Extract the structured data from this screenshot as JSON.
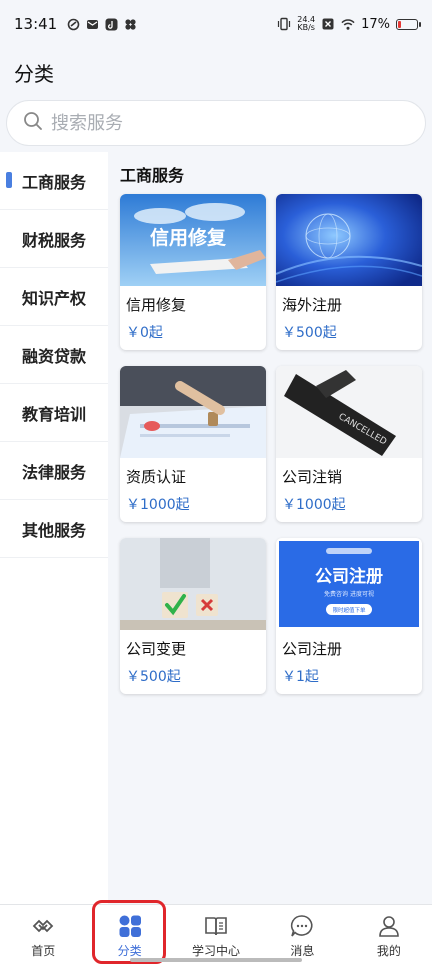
{
  "status": {
    "time": "13:41",
    "net_speed_value": "24.4",
    "net_speed_unit": "KB/s",
    "battery": "17%"
  },
  "page": {
    "title": "分类"
  },
  "search": {
    "placeholder": "搜索服务"
  },
  "sidebar": {
    "items": [
      {
        "label": "工商服务",
        "active": true
      },
      {
        "label": "财税服务"
      },
      {
        "label": "知识产权"
      },
      {
        "label": "融资贷款"
      },
      {
        "label": "教育培训"
      },
      {
        "label": "法律服务"
      },
      {
        "label": "其他服务"
      }
    ]
  },
  "section": {
    "title": "工商服务"
  },
  "cards": [
    {
      "name": "信用修复",
      "price": "￥0起",
      "overlay": "信用修复"
    },
    {
      "name": "海外注册",
      "price": "￥500起"
    },
    {
      "name": "资质认证",
      "price": "￥1000起"
    },
    {
      "name": "公司注销",
      "price": "￥1000起",
      "overlay": "CANCELLED"
    },
    {
      "name": "公司变更",
      "price": "￥500起"
    },
    {
      "name": "公司注册",
      "price": "￥1起",
      "overlay": "公司注册",
      "overlay_sub": "免费咨询  进度可视",
      "overlay_btn": "限时超值下单"
    }
  ],
  "tabbar": {
    "items": [
      {
        "label": "首页",
        "icon": "home-icon"
      },
      {
        "label": "分类",
        "icon": "category-grid-icon",
        "active": true
      },
      {
        "label": "学习中心",
        "icon": "book-icon"
      },
      {
        "label": "消息",
        "icon": "message-icon"
      },
      {
        "label": "我的",
        "icon": "user-icon"
      }
    ]
  },
  "colors": {
    "accent": "#3f6fd8",
    "price": "#2f6dc8",
    "highlight": "#e0262b"
  }
}
